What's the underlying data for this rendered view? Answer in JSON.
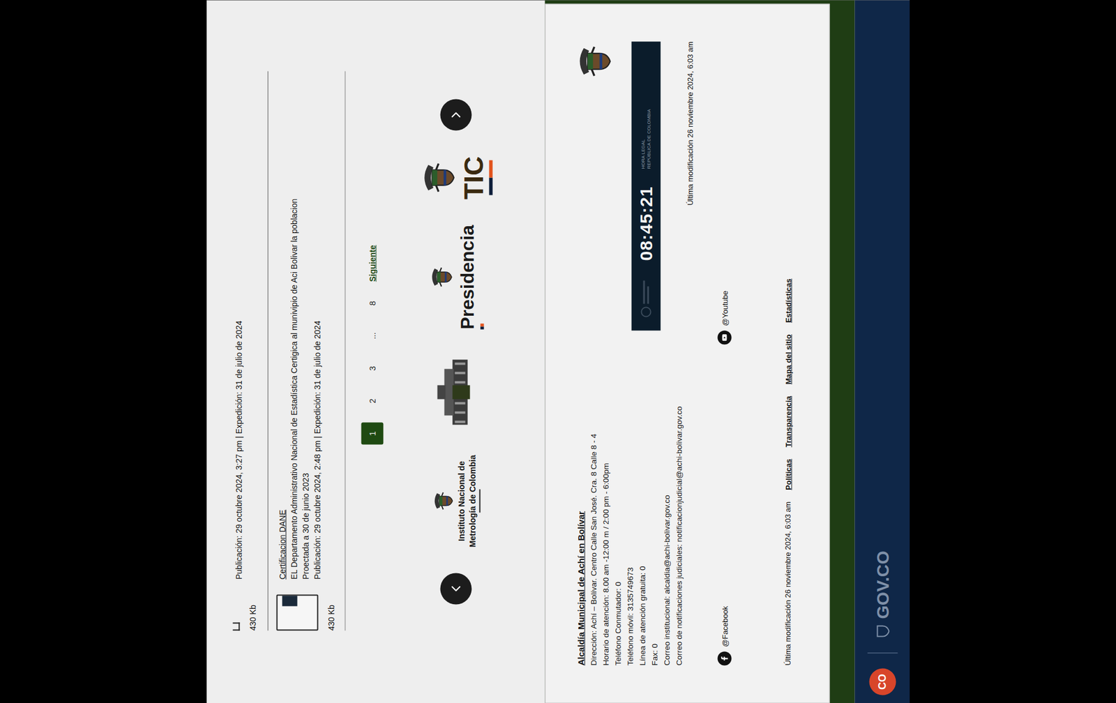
{
  "documents": {
    "partial": {
      "meta": "Publicación: 29 octubre 2024, 3:27 pm | Expedición: 31 de julio de 2024",
      "size": "430 Kb"
    },
    "items": [
      {
        "title": "Certificacion DANE",
        "description": [
          "EL Departamento Administrativo Nacional de Estadística Certigica al munivipio de Aci Bolivar la poblacion",
          "Proectada a 30 de junio 2023"
        ],
        "meta": "Publicación: 29 octubre 2024, 2:48 pm | Expedición: 31 de julio de 2024",
        "size": "430 Kb"
      }
    ]
  },
  "pagination": {
    "pages": [
      {
        "label": "1",
        "selected": true
      },
      {
        "label": "2",
        "selected": false
      },
      {
        "label": "3",
        "selected": false
      },
      {
        "label": "...",
        "selected": false
      },
      {
        "label": "8",
        "selected": false
      }
    ],
    "next": "Siguiente"
  },
  "logos": [
    {
      "kind": "inm",
      "lines": [
        "Instituto Nacional de",
        "Metrología de Colombia"
      ]
    },
    {
      "kind": "emblem",
      "lines": []
    },
    {
      "kind": "presidencia",
      "lines": [
        "Presidencia"
      ]
    },
    {
      "kind": "tic",
      "lines": [
        "TIC"
      ]
    }
  ],
  "footer": {
    "title": "Alcaldía Municipal de Achí en Bolívar",
    "details": [
      "Dirección: Achí – Bolívar. Centro Calle San José. Cra. 8 Calle 8 - 4",
      "Horario de atención: 8.00 am -12:00 m / 2:00 pm - 6:00pm",
      "Teléfono Conmutador: 0",
      "Teléfono móvil: 3135749673",
      "Línea de atención gratuita: 0",
      "Fax: 0",
      "Correo institucional: alcaldia@achi-bolivar.gov.co",
      "Correo de notificaciones judiciales: notificacionjudicial@achi-bolivar.gov.co"
    ],
    "clock": {
      "time": "08:45:21",
      "label": [
        "HORA LEGAL",
        "REPÚBLICA DE COLOMBIA"
      ]
    },
    "modified_top": "Última modificación 26 noviembre 2024, 6:03 am",
    "socials": [
      {
        "kind": "facebook",
        "label": "@Facebook"
      },
      {
        "kind": "youtube",
        "label": "@Youtube"
      }
    ],
    "modified_bottom": "Última modificación 26 noviembre 2024, 6:03 am",
    "links": [
      "Políticas",
      "Transparencia",
      "Mapa del sitio",
      "Estadísticas"
    ]
  },
  "govbar": {
    "badge": "CO",
    "brand": "GOV.CO"
  }
}
